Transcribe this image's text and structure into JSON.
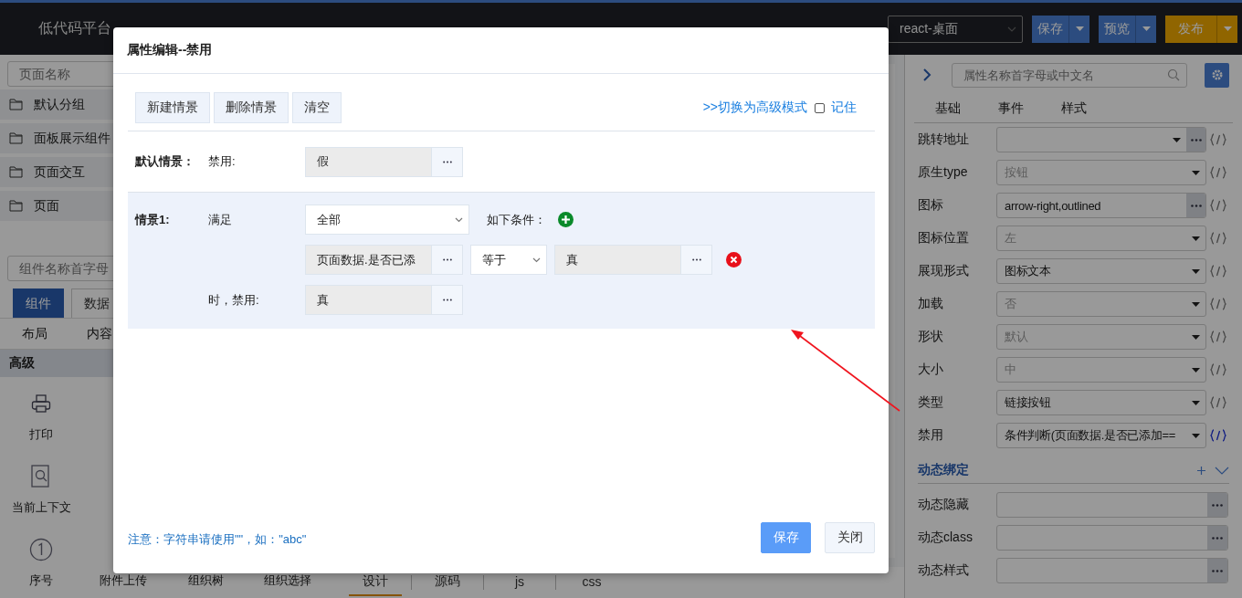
{
  "header": {
    "logo": "低代码平台",
    "platform_select": {
      "value": "react-桌面"
    },
    "buttons": [
      {
        "label": "保存",
        "kind": "primary"
      },
      {
        "label": "预览",
        "kind": "primary"
      },
      {
        "label": "发布",
        "kind": "warning"
      }
    ]
  },
  "left_panel": {
    "page_search": {
      "placeholder": "页面名称"
    },
    "groups": [
      "默认分组",
      "面板展示组件",
      "页面交互",
      "页面"
    ],
    "component_search": {
      "placeholder": "组件名称首字母"
    },
    "tabs": [
      {
        "label": "组件",
        "selected": true
      },
      {
        "label": "数据",
        "selected": false
      }
    ],
    "categories": [
      "布局",
      "内容"
    ],
    "section": "高级",
    "component_rows": [
      [
        {
          "label": "打印",
          "kind": "printer"
        }
      ],
      [
        {
          "label": "当前上下文",
          "kind": "lookup"
        }
      ],
      [
        {
          "label": "序号",
          "kind": "serial"
        },
        {
          "label": "附件上传",
          "kind": "upload"
        },
        {
          "label": "组织树",
          "kind": "tree"
        },
        {
          "label": "组织选择",
          "kind": "picker"
        }
      ]
    ]
  },
  "canvas_tabs": [
    {
      "label": "设计",
      "selected": true
    },
    {
      "label": "源码",
      "selected": false
    },
    {
      "label": "js",
      "selected": false
    },
    {
      "label": "css",
      "selected": false
    }
  ],
  "right_panel": {
    "search": {
      "placeholder": "属性名称首字母或中文名"
    },
    "tabs": [
      "基础",
      "事件",
      "样式"
    ],
    "rows": [
      {
        "label": "跳转地址",
        "kind": "select-more",
        "bound": false
      },
      {
        "label": "原生type",
        "kind": "select",
        "placeholder": "按钮",
        "bound": false
      },
      {
        "label": "图标",
        "kind": "input-more",
        "value": "arrow-right,outlined",
        "bound": false
      },
      {
        "label": "图标位置",
        "kind": "select",
        "placeholder": "左",
        "bound": false
      },
      {
        "label": "展现形式",
        "kind": "select",
        "value": "图标文本",
        "bound": false
      },
      {
        "label": "加载",
        "kind": "select",
        "placeholder": "否",
        "bound": false
      },
      {
        "label": "形状",
        "kind": "select",
        "placeholder": "默认",
        "bound": false
      },
      {
        "label": "大小",
        "kind": "select",
        "placeholder": "中",
        "bound": false
      },
      {
        "label": "类型",
        "kind": "select",
        "value": "链接按钮",
        "bound": false
      },
      {
        "label": "禁用",
        "kind": "select",
        "value": "条件判断(页面数据.是否已添加==",
        "bound": true
      }
    ],
    "dynamic_section": {
      "title": "动态绑定",
      "rows": [
        "动态隐藏",
        "动态class",
        "动态样式"
      ]
    }
  },
  "modal": {
    "title": "属性编辑--禁用",
    "toolbar": [
      "新建情景",
      "删除情景",
      "清空"
    ],
    "advanced_link": ">>切换为高级模式",
    "remember": {
      "label": "记住",
      "checked": false
    },
    "default_scenario": {
      "label": "默认情景：",
      "prop_label": "禁用:",
      "value": "假"
    },
    "scenarios": [
      {
        "label": "情景1:",
        "match_label": "满足",
        "match_select": "全部",
        "condition_label": "如下条件：",
        "conditions": [
          {
            "field": "页面数据.是否已添",
            "operator": "等于",
            "value": "真"
          }
        ],
        "result_label": "时，禁用:",
        "result": "真"
      }
    ],
    "note": "注意：字符串请使用\"\"，如：\"abc\"",
    "buttons": [
      {
        "label": "保存",
        "kind": "primary"
      },
      {
        "label": "关闭",
        "kind": "default"
      }
    ]
  }
}
